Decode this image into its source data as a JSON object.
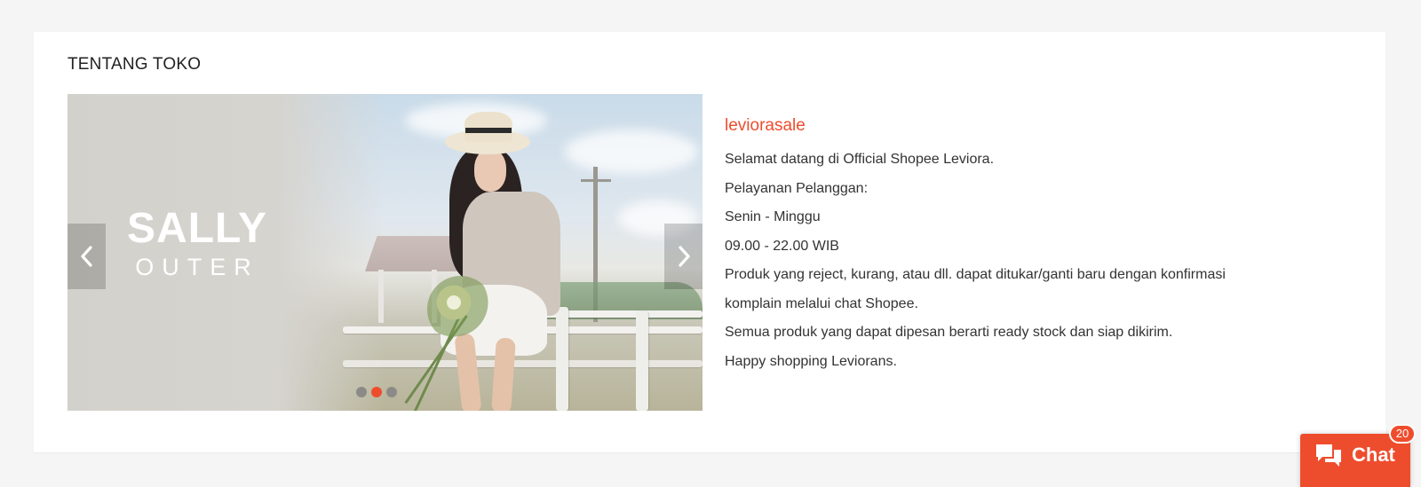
{
  "section": {
    "title": "TENTANG TOKO"
  },
  "carousel": {
    "brand_main": "SALLY",
    "brand_sub": "OUTER",
    "slide_count": 3,
    "active_slide_index": 1,
    "prev_icon": "chevron-left-icon",
    "next_icon": "chevron-right-icon"
  },
  "shop": {
    "name": "leviorasale",
    "description": [
      "Selamat datang di Official Shopee Leviora.",
      "Pelayanan Pelanggan:",
      "Senin - Minggu",
      "09.00 - 22.00 WIB",
      "Produk yang reject, kurang, atau dll. dapat ditukar/ganti baru dengan konfirmasi",
      "komplain melalui chat Shopee.",
      "Semua produk yang dapat dipesan berarti ready stock dan siap dikirim.",
      "Happy shopping Leviorans."
    ]
  },
  "chat": {
    "label": "Chat",
    "badge": "20",
    "icon": "chat-icon"
  },
  "colors": {
    "accent": "#ee4d2d",
    "page_bg": "#f5f5f5",
    "card_bg": "#ffffff"
  }
}
